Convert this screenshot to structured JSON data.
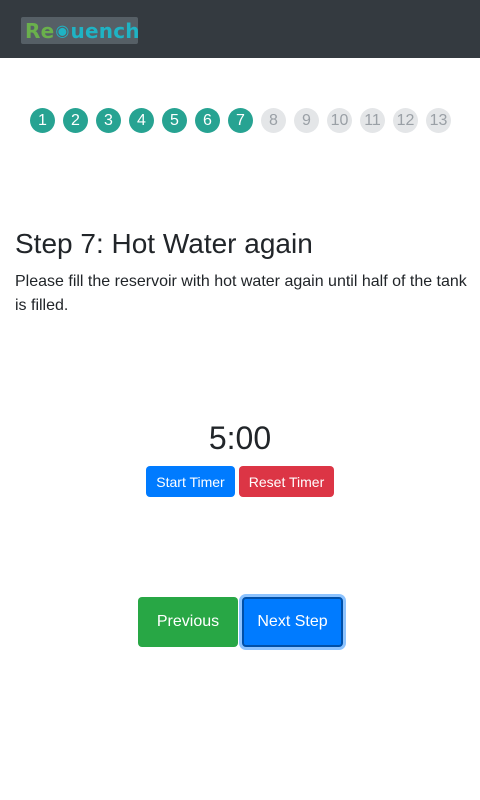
{
  "navbar": {
    "logo_part1": "Re",
    "logo_drop": "💧",
    "logo_part2": "uench"
  },
  "progress": {
    "current_step": 7,
    "steps": [
      "1",
      "2",
      "3",
      "4",
      "5",
      "6",
      "7",
      "8",
      "9",
      "10",
      "11",
      "12",
      "13"
    ]
  },
  "content": {
    "title": "Step 7: Hot Water again",
    "description": "Please fill the reservoir with hot water again until half of the tank is filled."
  },
  "timer": {
    "display": "5:00",
    "start_label": "Start Timer",
    "reset_label": "Reset Timer"
  },
  "navigation": {
    "previous_label": "Previous",
    "next_label": "Next Step"
  },
  "colors": {
    "navbar": "#343a40",
    "step_done": "#27a392",
    "step_todo": "#e4e6e8",
    "primary": "#007bff",
    "danger": "#dc3545",
    "success": "#28a745"
  }
}
